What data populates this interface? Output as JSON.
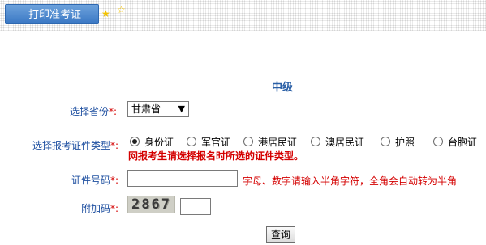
{
  "header": {
    "tab_label": "打印准考证"
  },
  "title": "中级",
  "province": {
    "label": "选择省份",
    "required_mark": "*:",
    "selected": "甘肃省"
  },
  "id_type": {
    "label": "选择报考证件类型",
    "required_mark": "*:",
    "options": [
      {
        "label": "身份证",
        "checked": true
      },
      {
        "label": "军官证",
        "checked": false
      },
      {
        "label": "港居民证",
        "checked": false
      },
      {
        "label": "澳居民证",
        "checked": false
      },
      {
        "label": "护照",
        "checked": false
      },
      {
        "label": "台胞证",
        "checked": false
      }
    ],
    "warning": "网报考生请选择报名时所选的证件类型。"
  },
  "id_number": {
    "label": "证件号码",
    "required_mark": "*:",
    "value": "",
    "hint": "字母、数字请输入半角字符，全角会自动转为半角"
  },
  "captcha": {
    "label": "附加码",
    "required_mark": "*:",
    "code": "2867",
    "value": ""
  },
  "submit": {
    "label": "查询"
  }
}
